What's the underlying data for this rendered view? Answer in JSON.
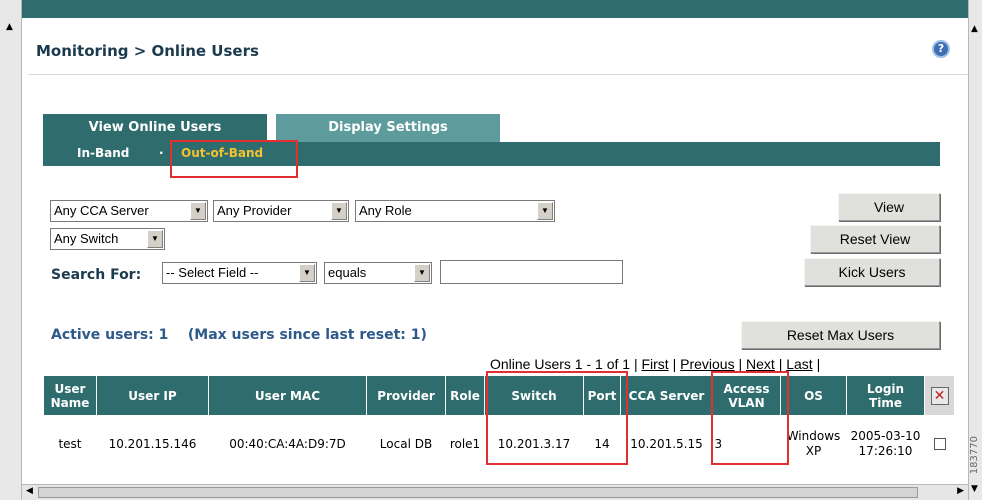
{
  "header": {
    "title": "Monitoring > Online Users",
    "help_icon": "help-icon"
  },
  "tabs": [
    {
      "label": "View Online Users",
      "active": true
    },
    {
      "label": "Display Settings",
      "active": false
    }
  ],
  "subnav": {
    "inband": "In-Band",
    "separator": "·",
    "oob": "Out-of-Band",
    "oob_color": "#f2c230"
  },
  "filters": {
    "cca_server": "Any CCA Server",
    "provider": "Any Provider",
    "role": "Any Role",
    "switch": "Any Switch",
    "search_label": "Search For:",
    "search_field": "-- Select Field --",
    "operator": "equals",
    "search_value": ""
  },
  "buttons": {
    "view": "View",
    "reset_view": "Reset View",
    "kick_users": "Kick Users",
    "reset_max": "Reset Max Users"
  },
  "summary": {
    "active_users": "Active users: 1",
    "max_users": "(Max users since last reset: 1)"
  },
  "pager": {
    "prefix": "Online Users 1 - 1 of 1 |",
    "first": "First",
    "previous": "Previous",
    "next": "Next",
    "last": "Last",
    "sep": "|"
  },
  "table": {
    "headers": [
      "User Name",
      "User IP",
      "User MAC",
      "Provider",
      "Role",
      "Switch",
      "Port",
      "CCA Server",
      "Access VLAN",
      "OS",
      "Login Time"
    ],
    "rows": [
      {
        "user": "test",
        "ip": "10.201.15.146",
        "mac": "00:40:CA:4A:D9:7D",
        "provider": "Local DB",
        "role": "role1",
        "switch": "10.201.3.17",
        "port": "14",
        "cca_server": "10.201.5.15",
        "vlan": "3",
        "os": "Windows XP",
        "login_time": "2005-03-10 17:26:10"
      }
    ]
  },
  "watermark": "183770",
  "colors": {
    "teal": "#2f6c6e",
    "teal_light": "#5e9b9c",
    "highlight": "#e23030"
  }
}
